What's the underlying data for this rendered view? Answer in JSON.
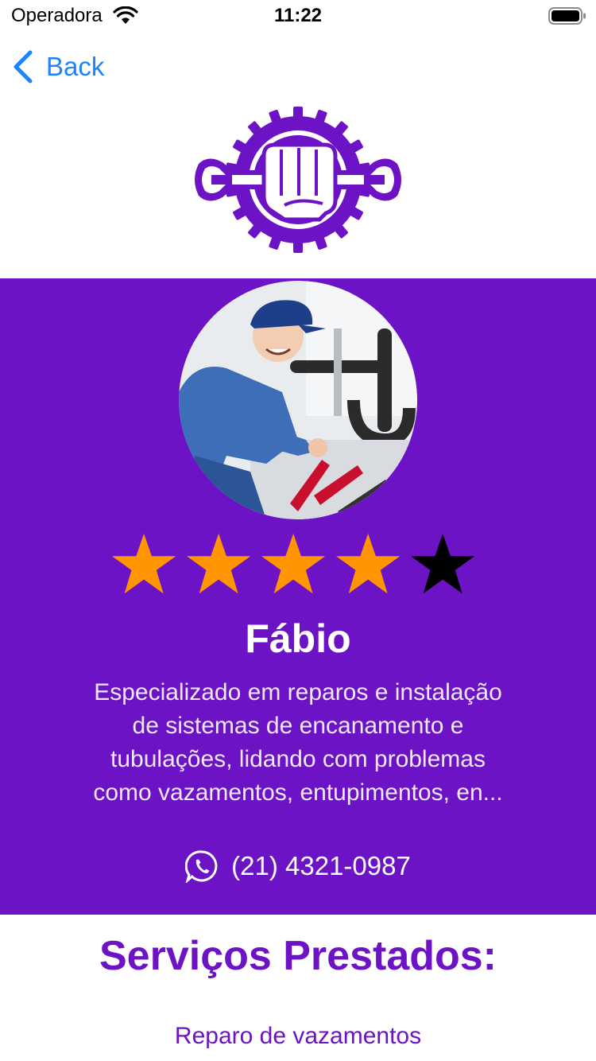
{
  "status_bar": {
    "carrier": "Operadora",
    "time": "11:22"
  },
  "nav": {
    "back_label": "Back"
  },
  "theme": {
    "primary": "#6d13c6",
    "accent_link": "#1a84ff",
    "star_filled": "#ff9500",
    "star_empty": "#000000"
  },
  "profile": {
    "name": "Fábio",
    "rating": 4,
    "rating_max": 5,
    "description_lines": [
      "Especializado em reparos e instalação",
      "de sistemas de encanamento e",
      "tubulações, lidando com problemas",
      "como vazamentos, entupimentos, en..."
    ],
    "phone": "(21) 4321-0987",
    "phone_icon": "whatsapp-icon"
  },
  "services": {
    "title": "Serviços Prestados:",
    "items": [
      "Reparo de vazamentos"
    ]
  }
}
